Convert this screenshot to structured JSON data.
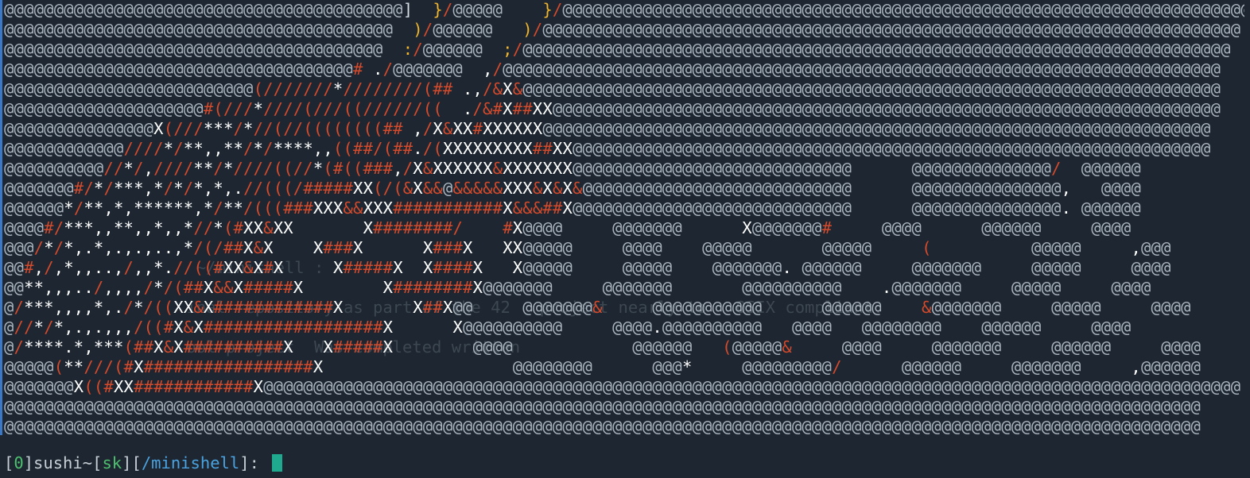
{
  "terminal": {
    "background_color": "#1e2731",
    "accent_color": "#3b79c6",
    "ghost_text": [
      "",
      "",
      "",
      "",
      "",
      "",
      "",
      "",
      "",
      "",
      "",
      "",
      "",
      "                    ~/minishell :",
      "",
      "                   inal repository as part of the 42   project nearly to   OSIX compliant.",
      "",
      "                   ool project  Was completed written",
      "",
      "",
      ""
    ],
    "art_lines": [
      "@@@@@@@@@@@@@@@@@@@@@@@@@@@@@@@@@@@@@@@@]  }/@@@@@    }/@@@@@@@@@@@@@@@@@@@@@@@@@@@@@@@@@@@@@@@@@@@@@@@@@@@@@@@@@@@@@@@@@@@@@",
      "@@@@@@@@@@@@@@@@@@@@@@@@@@@@@@@@@@@@@@@  )/@@@@@@   )/@@@@@@@@@@@@@@@@@@@@@@@@@@@@@@@@@@@@@@@@@@@@@@@@@@@@@@@@@@@@@@@@@@@@@@",
      "@@@@@@@@@@@@@@@@@@@@@@@@@@@@@@@@@@@@@@  :/@@@@@@  ;/@@@@@@@@@@@@@@@@@@@@@@@@@@@@@@@@@@@@@@@@@@@@@@@@@@@@@@@@@@@@@@@@@@@@@@@",
      "@@@@@@@@@@@@@@@@@@@@@@@@@@@@@@@@@@@# ./@@@@@@@  ,/@@@@@@@@@@@@@@@@@@@@@@@@@@@@@@@@@@@@@@@@@@@@@@@@@@@@@@@@@@@@@@@@@@@@@@@@",
      "@@@@@@@@@@@@@@@@@@@@@@@@@(///////*////////(## .,/&X&@@@@@@@@@@@@@@@@@@@@@@@@@@@@@@@@@@@@@@@@@@@@@@@@@@@@@@@@@@@@@@@@@@@@@@",
      "@@@@@@@@@@@@@@@@@@@@#(///*////(///((//////((  ./&#X##XX@@@@@@@@@@@@@@@@@@@@@@@@@@@@@@@@@@@@@@@@@@@@@@@@@@@@@@@@@@@@@@@@@@@",
      "@@@@@@@@@@@@@@@X(///***/*//(//((((((((## ,/X&XX#XXXXXX@@@@@@@@@@@@@@@@@@@@@@@@@@@@@@@@@@@@@@@@@@@@@@@@@@@@@@@@@@@@@@@@@@@",
      "@@@@@@@@@@@@////*/**,,**/*/****,,((##/(##./(XXXXXXXXX##XX@@@@@@@@@@@@@@@@@@@@@@@@@@@@@@@@@@@@@@@@@@@@@@@@@@@@@@@@@@@@@@@@",
      "@@@@@@@@@@//*/,////**/*////((//*(#((###,/X&XXXXXX&XXXXXXX@@@@@@@@@@@@@@@@@@@@@@@@@@@@      @@@@@@@@@@@@@@/  @@@@@@",
      "@@@@@@@#/*/***,*/*/*,*,.//(((/#####XX(/(&X&&@&&&&&XXX&X&X&@@@@@@@@@@@@@@@@@@@@@@@@@@@      @@@@@@@@@@@@@@@,   @@@@",
      "@@@@@@*/**,*,******,*/**/(((###XXX&&XXX###########X&&&##X@@@@@@@@@@@@@@@@@@@@@@@@@@@@      @@@@@@@@@@@@@@@. @@@@@@",
      "@@@@#/***,,**,,*,,*//*(#XX&XX       X########/    #X@@@@     @@@@@@@      X@@@@@@@#     @@@@      @@@@@@     @@@@",
      "@@@/*/*,.*,.,.,..,*/(/##X&X    X###X      X###X   XX@@@@@     @@@@    @@@@@       @@@@@     (          @@@@@     ,@@@",
      "@@#,/,*,,..,/,,*.//((#XX&X#X     X#####X  X####X   X@@@@@     @@@@@    @@@@@@@. @@@@@@     @@@@@@@     @@@@@     @@@@",
      "@@**,,,../,,,,/*/(##X&&X#####X        X########X@@@@@@@     @@@@@@@       @@@@@@@@@@    .@@@@@@@     @@@@@     @@@@",
      "@/***,,,,*,./*/((XX&X############X       X##X@@     @@@@@@@&     @@@@@@@@@@@      @@@@@@    &@@@@@@@     @@@@@     @@@@",
      "@//*/*,.,.,,,/((#X&X##################X      X@@@@@@@@@@     @@@@.@@@@@@@@@@   @@@@   @@@@@@@@    @@@@@@     @@@@",
      "@/****.*,***(##X&X##########X   X#####X        @@@@            @@@@@@   (@@@@@&     @@@@     @@@@@@@     @@@@@@     @@@@",
      "@@@@@(**///(#X#################X                   @@@@@@@@      @@@*     @@@@@@@@@/      @@@@@@     @@@@@@@     ,@@@@@@     @@@@",
      "@@@@@@@X((#XX############X@@@@@@@@@@@@@@@@@@@@@@@@@@@@@@@@@@@@@@@@@@@@@@@@@@@@@@@@@@@@@@@@@@@@@@@@@@@@@@@@@@@@@@@@@@@@@@@@@@",
      "@@@@@@@@@@@@@@@@@@@@@@@@@@@@@@@@@@@@@@@@@@@@@@@@@@@@@@@@@@@@@@@@@@@@@@@@@@@@@@@@@@@@@@@@@@@@@@@@@@@@@@@@@@@@@@@@@@@@@@@@",
      "@@@@@@@@@@@@@@@@@@@@@@@@@@@@@@@@@@@@@@@@@@@@@@@@@@@@@@@@@@@@@@@@@@@@@@@@@@@@@@@@@@@@@@@@@@@@@@@@@@@@@@@@@@@@@@@@@@@@@@@@"
    ]
  },
  "prompt": {
    "open_bracket": "[",
    "exit_code": "0",
    "close_bracket": "]",
    "user_host": "sushi~",
    "branch_open": "[",
    "branch": "sk",
    "branch_close": "]",
    "dir_open": "[",
    "directory": "/minishell",
    "dir_close": "]",
    "suffix": ": "
  }
}
